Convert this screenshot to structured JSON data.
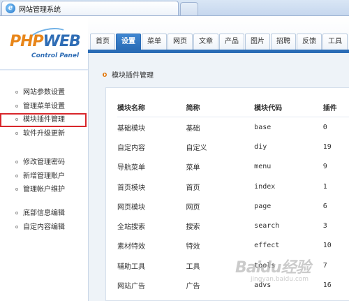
{
  "browser": {
    "tab_title": "网站管理系统",
    "icon": "ie-icon"
  },
  "logo": {
    "text_php": "PHP",
    "text_web": "WEB",
    "subtitle": "Control Panel"
  },
  "sidebar": {
    "groups": [
      {
        "items": [
          {
            "label": "网站参数设置"
          },
          {
            "label": "管理菜单设置"
          },
          {
            "label": "模块插件管理"
          },
          {
            "label": "软件升级更新"
          }
        ]
      },
      {
        "items": [
          {
            "label": "修改管理密码"
          },
          {
            "label": "新增管理账户"
          },
          {
            "label": "管理帐户维护"
          }
        ]
      },
      {
        "items": [
          {
            "label": "底部信息编辑"
          },
          {
            "label": "自定内容编辑"
          }
        ]
      }
    ],
    "selected_label": "模块插件管理"
  },
  "nav": {
    "tabs": [
      {
        "label": "首页"
      },
      {
        "label": "设置"
      },
      {
        "label": "菜单"
      },
      {
        "label": "网页"
      },
      {
        "label": "文章"
      },
      {
        "label": "产品"
      },
      {
        "label": "图片"
      },
      {
        "label": "招聘"
      },
      {
        "label": "反馈"
      },
      {
        "label": "工具"
      }
    ],
    "active": "设置"
  },
  "main": {
    "section_title": "模块插件管理",
    "table": {
      "headers": [
        "模块名称",
        "简称",
        "模块代码",
        "插件"
      ],
      "rows": [
        [
          "基础模块",
          "基础",
          "base",
          "0"
        ],
        [
          "自定内容",
          "自定义",
          "diy",
          "19"
        ],
        [
          "导航菜单",
          "菜单",
          "menu",
          "9"
        ],
        [
          "首页模块",
          "首页",
          "index",
          "1"
        ],
        [
          "网页模块",
          "网页",
          "page",
          "6"
        ],
        [
          "全站搜索",
          "搜索",
          "search",
          "3"
        ],
        [
          "素材特效",
          "特效",
          "effect",
          "10"
        ],
        [
          "辅助工具",
          "工具",
          "tools",
          "7"
        ],
        [
          "网站广告",
          "广告",
          "advs",
          "16"
        ]
      ]
    }
  },
  "watermark": {
    "main": "Baidu经验",
    "sub": "jingyan.baidu.com"
  },
  "colors": {
    "accent": "#2a6cb6",
    "selected_border": "#d8262b",
    "bullet_orange": "#e07a12"
  }
}
